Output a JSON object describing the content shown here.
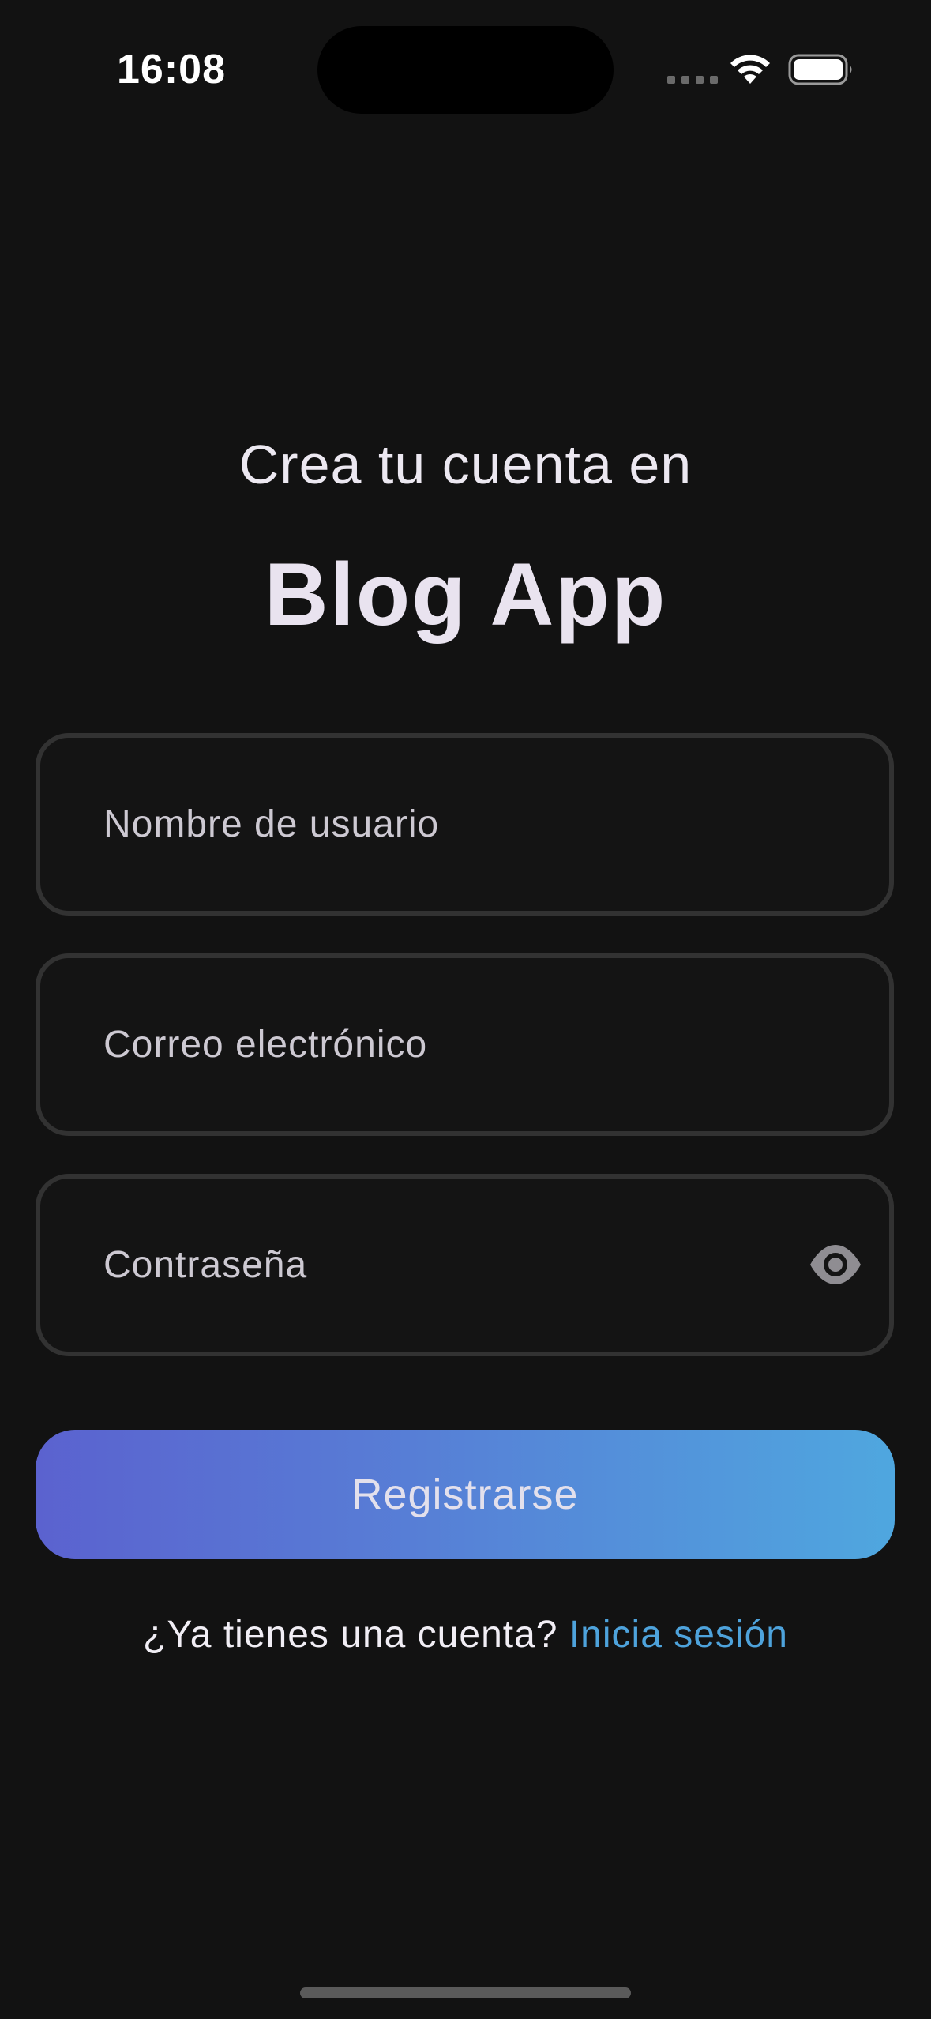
{
  "status_bar": {
    "time": "16:08",
    "icons": [
      "cellular-signal-icon",
      "wifi-icon",
      "battery-icon"
    ]
  },
  "header": {
    "subtitle": "Crea tu cuenta en",
    "title": "Blog App"
  },
  "form": {
    "username_placeholder": "Nombre de usuario",
    "email_placeholder": "Correo electrónico",
    "password_placeholder": "Contraseña",
    "password_toggle_icon": "eye-icon",
    "submit_label": "Registrarse"
  },
  "footer": {
    "prompt": "¿Ya tienes una cuenta? ",
    "link_label": "Inicia sesión"
  },
  "colors": {
    "background": "#121212",
    "field_border": "#323232",
    "button_gradient_start": "#5b62cf",
    "button_gradient_end": "#4fa7df",
    "link": "#4ea3dc"
  }
}
